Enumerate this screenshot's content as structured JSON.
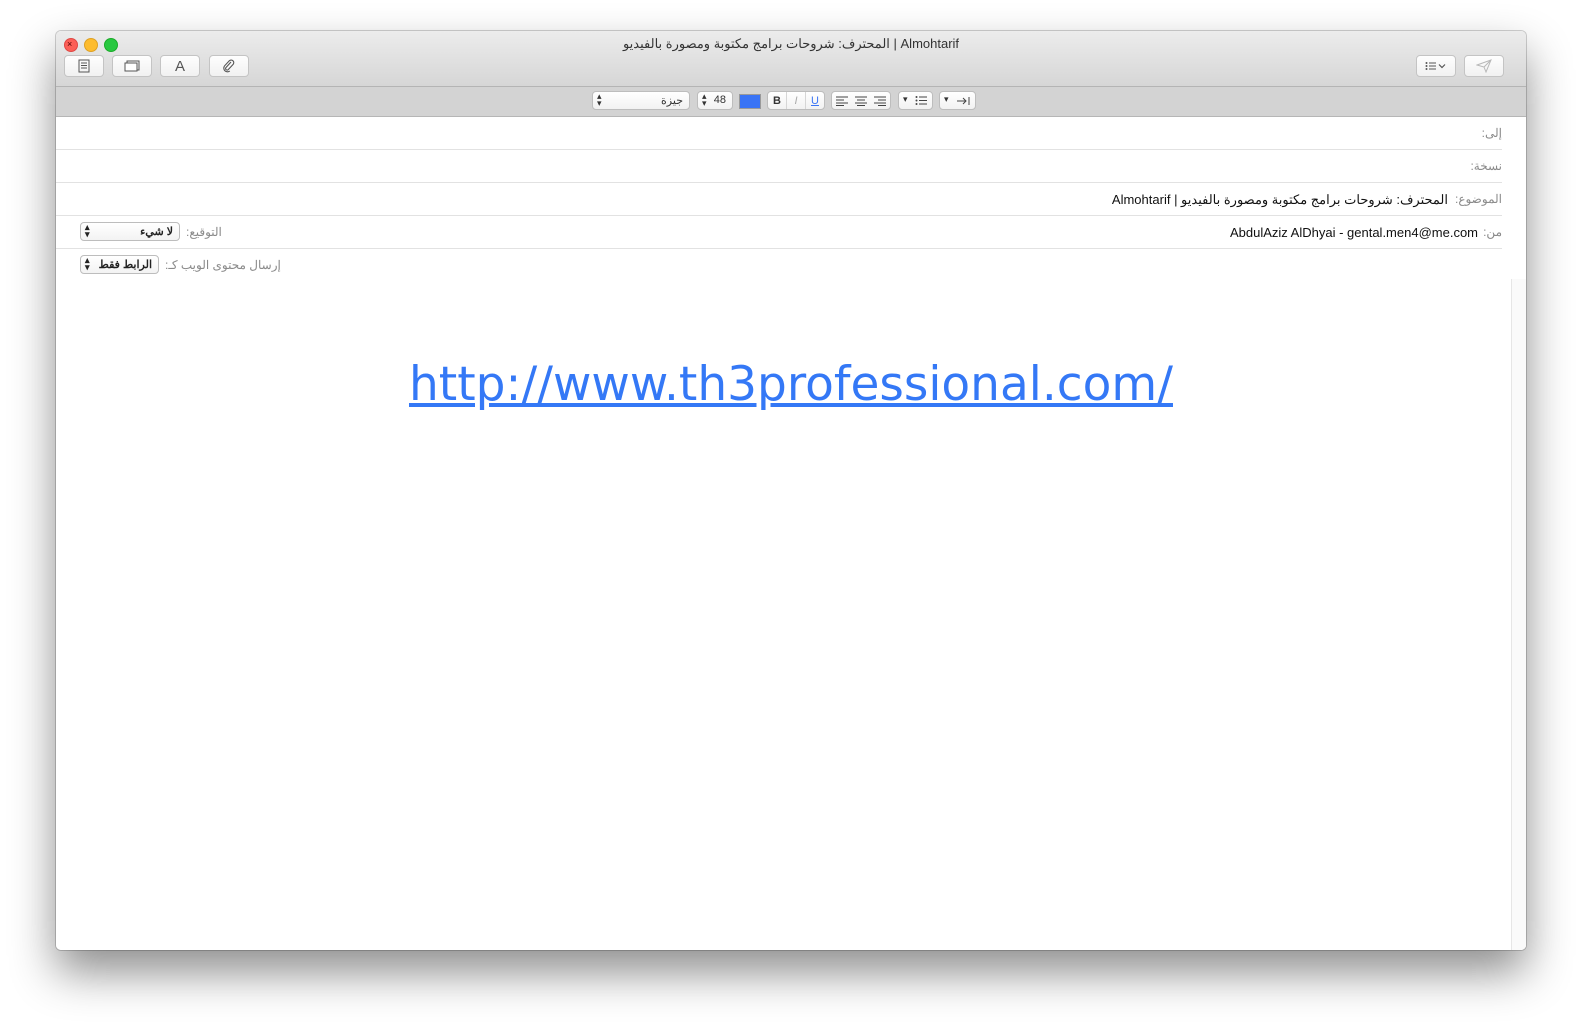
{
  "window": {
    "title": "المحترف: شروحات برامج مكتوبة ومصورة بالفيديو | Almohtarif"
  },
  "toolbar": {
    "buttons": [
      {
        "name": "header-fields-button",
        "icon": "form-icon"
      },
      {
        "name": "browser-tab-button",
        "icon": "window-icon"
      },
      {
        "name": "fonts-button",
        "icon": "font-icon",
        "label": "A"
      },
      {
        "name": "attach-button",
        "icon": "paperclip-icon"
      }
    ],
    "right": [
      {
        "name": "list-menu-button",
        "icon": "list-icon"
      },
      {
        "name": "send-button",
        "icon": "paper-plane-icon"
      }
    ]
  },
  "format_bar": {
    "font_name": "جيزة",
    "font_size": "48",
    "text_color": "#3a74f5",
    "bold": "B",
    "italic": "I",
    "underline": "U"
  },
  "headers": {
    "to_label": "إلى:",
    "cc_label": "نسخة:",
    "subject_label": "الموضوع:",
    "subject_value": "المحترف: شروحات برامج مكتوبة ومصورة بالفيديو | Almohtarif",
    "from_label": "من:",
    "from_value": "AbdulAziz AlDhyai - gental.men4@me.com",
    "signature_label": "التوقيع:",
    "signature_value": "لا شيء",
    "send_web_label": "إرسال محتوى الويب كـ:",
    "send_web_value": "الرابط فقط"
  },
  "body": {
    "link": "http://www.th3professional.com/"
  },
  "colors": {
    "accent": "#3478f6"
  }
}
